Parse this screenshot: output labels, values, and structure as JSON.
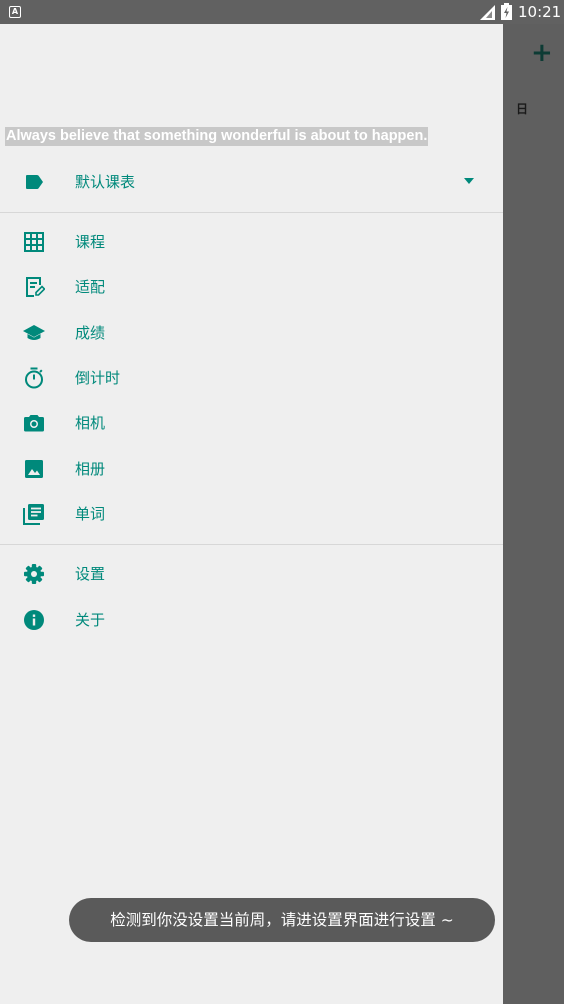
{
  "status_bar": {
    "app_icon": "A",
    "time": "10:21",
    "signal_icon": "cell-signal-icon",
    "battery_icon": "battery-icon"
  },
  "behind": {
    "plus": "+",
    "day": "日"
  },
  "drawer": {
    "quote": "Always believe that something wonderful is about to happen.",
    "schedule": {
      "label": "默认课表",
      "icon": "label-tag-icon"
    },
    "menu": [
      {
        "label": "课程",
        "icon": "grid-icon"
      },
      {
        "label": "适配",
        "icon": "edit-note-icon"
      },
      {
        "label": "成绩",
        "icon": "graduation-cap-icon"
      },
      {
        "label": "倒计时",
        "icon": "timer-icon"
      },
      {
        "label": "相机",
        "icon": "camera-icon"
      },
      {
        "label": "相册",
        "icon": "image-icon"
      },
      {
        "label": "单词",
        "icon": "library-books-icon"
      }
    ],
    "menu2": [
      {
        "label": "设置",
        "icon": "gear-icon"
      },
      {
        "label": "关于",
        "icon": "info-icon"
      }
    ]
  },
  "toast": {
    "text": "检测到你没设置当前周，请进设置界面进行设置 ~"
  },
  "colors": {
    "accent": "#00897b",
    "drawer_bg": "#efefef",
    "scrim": "#5f5f5f",
    "status_bar": "#616161"
  }
}
